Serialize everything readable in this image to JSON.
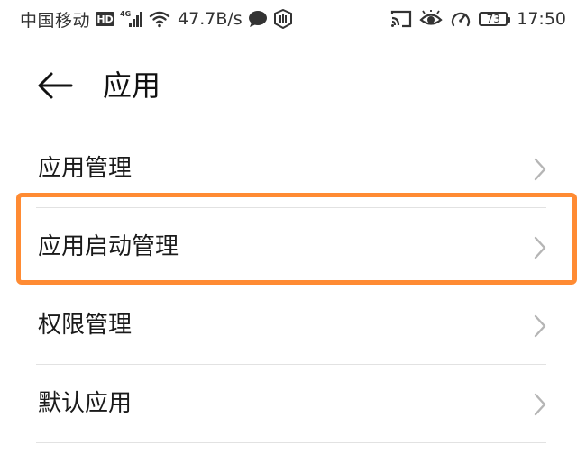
{
  "status_bar": {
    "carrier": "中国移动",
    "hd_badge": "HD",
    "network_type": "4G",
    "net_speed": "47.7B/s",
    "battery_level": "73",
    "time": "17:50",
    "left_icons": [
      "hd-icon",
      "signal-4g-icon",
      "wifi-icon",
      "chat-bubble-icon",
      "shield-hand-icon"
    ],
    "right_icons": [
      "cast-icon",
      "eye-icon",
      "speedometer-icon",
      "battery-icon"
    ]
  },
  "header": {
    "back_icon": "arrow-left-icon",
    "title": "应用"
  },
  "list": {
    "items": [
      {
        "label": "应用管理"
      },
      {
        "label": "应用启动管理"
      },
      {
        "label": "权限管理"
      },
      {
        "label": "默认应用"
      }
    ]
  },
  "colors": {
    "highlight": "#ff8b33",
    "divider": "#e2e2e2",
    "chevron": "#b5b5b5",
    "text": "#1a1a1a"
  }
}
